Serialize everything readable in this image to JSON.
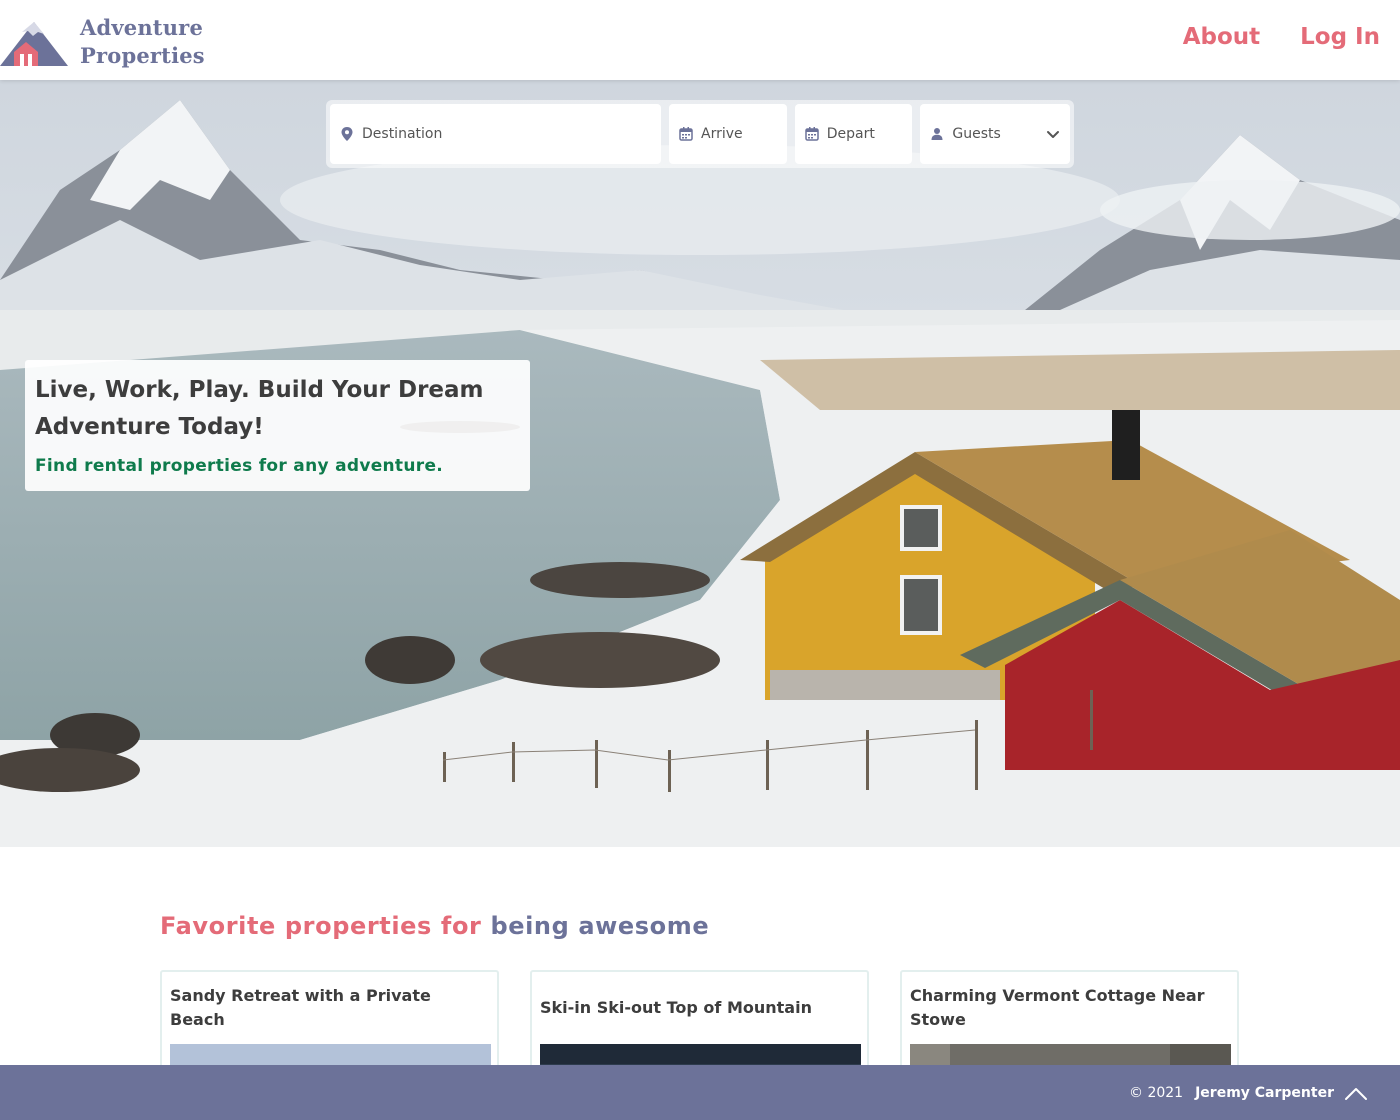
{
  "header": {
    "logo_line1": "Adventure",
    "logo_line2": "Properties",
    "nav": {
      "about": "About",
      "login": "Log In"
    }
  },
  "search": {
    "destination_placeholder": "Destination",
    "arrive_placeholder": "Arrive",
    "depart_placeholder": "Depart",
    "guests_label": "Guests",
    "icons": [
      "map-pin-icon",
      "calendar-icon",
      "calendar-icon",
      "person-icon",
      "chevron-down-icon"
    ]
  },
  "hero": {
    "headline": "Live, Work, Play. Build Your Dream Adventure Today!",
    "subhead": "Find rental properties for any adventure."
  },
  "favorites": {
    "heading_part1": "Favorite properties for",
    "heading_part2": "being awesome",
    "cards": [
      {
        "title": "Sandy Retreat with a Private Beach"
      },
      {
        "title": "Ski-in Ski-out Top of Mountain"
      },
      {
        "title": "Charming Vermont Cottage Near Stowe"
      }
    ]
  },
  "footer": {
    "copyright": "© 2021",
    "author": "Jeremy Carpenter"
  },
  "colors": {
    "brand_slate": "#6c7299",
    "brand_coral": "#e46b78",
    "subhead_green": "#0f7b4c"
  }
}
